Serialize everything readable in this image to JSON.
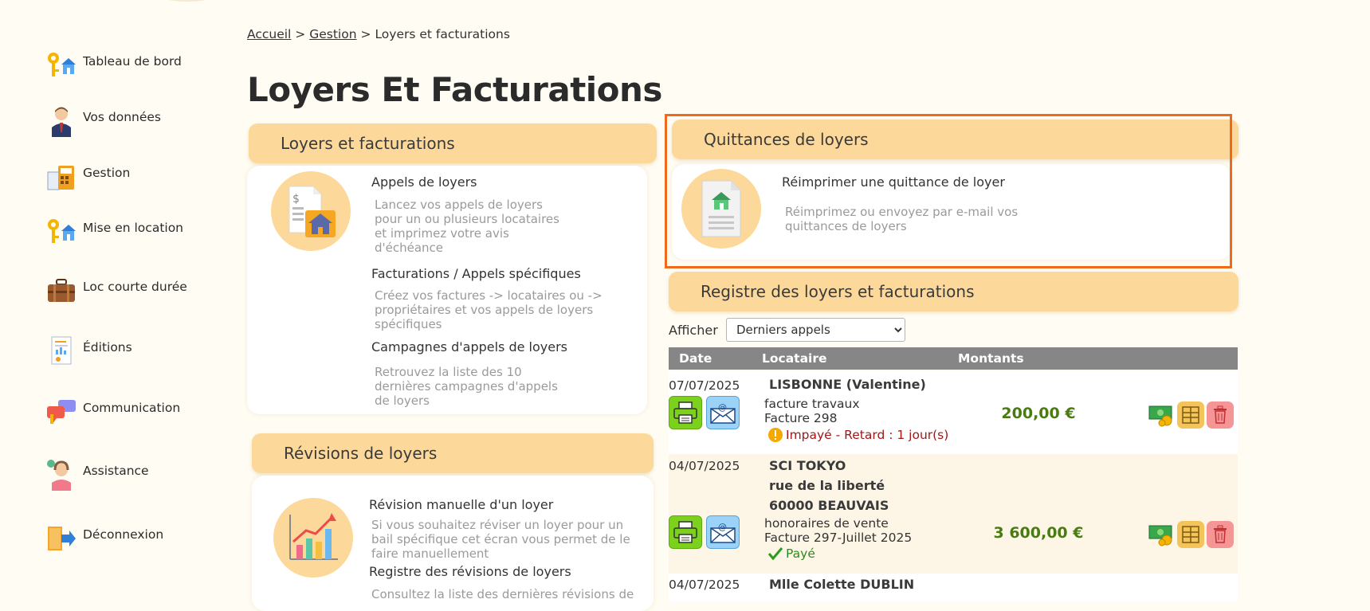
{
  "sidebar": {
    "items": [
      {
        "label": "Tableau de bord",
        "icon": "keys-house-icon"
      },
      {
        "label": "Vos données",
        "icon": "user-icon"
      },
      {
        "label": "Gestion",
        "icon": "calculator-icon"
      },
      {
        "label": "Mise en location",
        "icon": "keys-house-icon"
      },
      {
        "label": "Loc courte durée",
        "icon": "suitcase-icon"
      },
      {
        "label": "Éditions",
        "icon": "report-icon"
      },
      {
        "label": "Communication",
        "icon": "chat-bubbles-icon"
      },
      {
        "label": "Assistance",
        "icon": "support-agent-icon"
      },
      {
        "label": "Déconnexion",
        "icon": "logout-icon"
      }
    ]
  },
  "breadcrumb": {
    "home": "Accueil",
    "sep1": ">",
    "section": "Gestion",
    "sep2": ">",
    "current": "Loyers et facturations"
  },
  "page_title": "Loyers Et Facturations",
  "panel_loyers": {
    "title": "Loyers et facturations",
    "links": [
      {
        "title": "Appels de loyers",
        "desc": "Lancez vos appels de loyers pour un ou plusieurs locataires et imprimez votre avis d'échéance"
      },
      {
        "title": "Facturations / Appels spécifiques",
        "desc": "Créez vos factures -> locataires ou -> propriétaires et vos appels de loyers spécifiques"
      },
      {
        "title": "Campagnes d'appels de loyers",
        "desc": "Retrouvez la liste des 10 dernières campagnes d'appels de loyers"
      }
    ]
  },
  "panel_quittances": {
    "title": "Quittances de loyers",
    "link_title": "Réimprimer une quittance de loyer",
    "link_desc": "Réimprimez ou envoyez par e-mail vos quittances de loyers"
  },
  "panel_revisions": {
    "title": "Révisions de loyers",
    "links": [
      {
        "title": "Révision manuelle d'un loyer",
        "desc": "Si vous souhaitez réviser un loyer pour un bail spécifique cet écran vous permet de le faire manuellement"
      },
      {
        "title": "Registre des révisions de loyers",
        "desc": "Consultez la liste des dernières révisions de"
      }
    ]
  },
  "register": {
    "title": "Registre des loyers et facturations",
    "filter_label": "Afficher",
    "filter_value": "Derniers appels",
    "columns": [
      "Date",
      "Locataire",
      "Montants"
    ],
    "rows": [
      {
        "date": "07/07/2025",
        "name_lines": [
          "LISBONNE (Valentine)"
        ],
        "desc_lines": [
          "facture travaux",
          "Facture 298"
        ],
        "status": "Impayé - Retard : 1 jour(s)",
        "status_type": "unpaid",
        "amount": "200,00 €"
      },
      {
        "date": "04/07/2025",
        "name_lines": [
          "SCI TOKYO",
          "rue de la liberté",
          "60000 BEAUVAIS"
        ],
        "desc_lines": [
          "honoraires de vente",
          "Facture 297-Juillet 2025"
        ],
        "status": "Payé",
        "status_type": "paid",
        "amount": "3 600,00 €"
      },
      {
        "date": "04/07/2025",
        "name_lines": [
          "Mlle Colette DUBLIN"
        ]
      }
    ]
  },
  "colors": {
    "panel_header": "#fcd99a",
    "highlight": "#ef6a1a",
    "amount": "#4a7a12",
    "unpaid": "#a01818",
    "paid": "#2e8a1e",
    "table_header": "#868686"
  }
}
